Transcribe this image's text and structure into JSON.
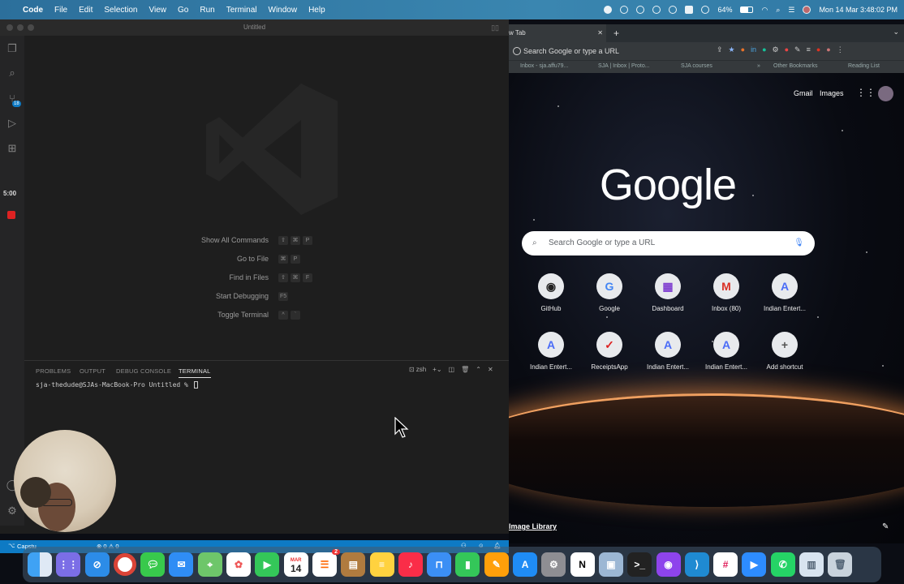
{
  "menubar": {
    "apple": "",
    "app": "Code",
    "items": [
      "File",
      "Edit",
      "Selection",
      "View",
      "Go",
      "Run",
      "Terminal",
      "Window",
      "Help"
    ],
    "battery": "64%",
    "datetime": "Mon 14 Mar  3:48:02 PM"
  },
  "vscode": {
    "title": "Untitled",
    "timer": "5:00",
    "badge": "18",
    "commands": [
      {
        "label": "Show All Commands",
        "keys": [
          "⇧",
          "⌘",
          "P"
        ]
      },
      {
        "label": "Go to File",
        "keys": [
          "⌘",
          "P"
        ]
      },
      {
        "label": "Find in Files",
        "keys": [
          "⇧",
          "⌘",
          "F"
        ]
      },
      {
        "label": "Start Debugging",
        "keys": [
          "F5"
        ]
      },
      {
        "label": "Toggle Terminal",
        "keys": [
          "^",
          "`"
        ]
      }
    ],
    "panel_tabs": [
      "PROBLEMS",
      "OUTPUT",
      "DEBUG CONSOLE",
      "TERMINAL"
    ],
    "terminal_shell": "zsh",
    "terminal_prompt": "sja-thedude@SJAs-MacBook-Pro Untitled % ",
    "status_left": "Capstu",
    "status_problems": "⊗ 0  ⚠ 0"
  },
  "chrome": {
    "tab_title": "w Tab",
    "omnibox": "Search Google or type a URL",
    "bookmarks": [
      "Inbox - sja.affu79...",
      "SJA | Inbox | Proto...",
      "SJA courses",
      "Other Bookmarks",
      "Reading List"
    ],
    "top_links": [
      "Gmail",
      "Images"
    ],
    "logo": "Google",
    "search_placeholder": "Search Google or type a URL",
    "shortcuts": [
      {
        "label": "GitHub",
        "icon": "github-icon"
      },
      {
        "label": "Google",
        "icon": "google-icon"
      },
      {
        "label": "Dashboard",
        "icon": "dashboard-icon"
      },
      {
        "label": "Inbox (80)",
        "icon": "gmail-icon"
      },
      {
        "label": "Indian Entert...",
        "icon": "a-icon"
      },
      {
        "label": "Indian Entert...",
        "icon": "a-icon"
      },
      {
        "label": "ReceiptsApp",
        "icon": "receipts-icon"
      },
      {
        "label": "Indian Entert...",
        "icon": "a-icon"
      },
      {
        "label": "Indian Entert...",
        "icon": "a-icon"
      },
      {
        "label": "Add shortcut",
        "icon": "plus-icon"
      }
    ],
    "image_credit": "Image Library"
  },
  "dock": {
    "calendar_month": "MAR",
    "calendar_day": "14",
    "reminders_badge": "2",
    "apps": [
      "finder",
      "launchpad",
      "safari",
      "chrome",
      "messages",
      "mail",
      "maps",
      "photos",
      "facetime",
      "calendar",
      "reminders",
      "notes",
      "stickies",
      "music",
      "keynote",
      "numbers",
      "pages",
      "app-store",
      "system-preferences",
      "notion",
      "preview",
      "terminal",
      "github-desktop",
      "vscode",
      "slack",
      "zoom",
      "whatsapp",
      "files",
      "trash"
    ]
  },
  "colors": {
    "menubar": "#2f77a3",
    "vscode_bg": "#1e1e1e",
    "statusbar": "#0e7ac4",
    "chrome_bar": "#35393c",
    "accent_blue": "#8ab4f8"
  }
}
